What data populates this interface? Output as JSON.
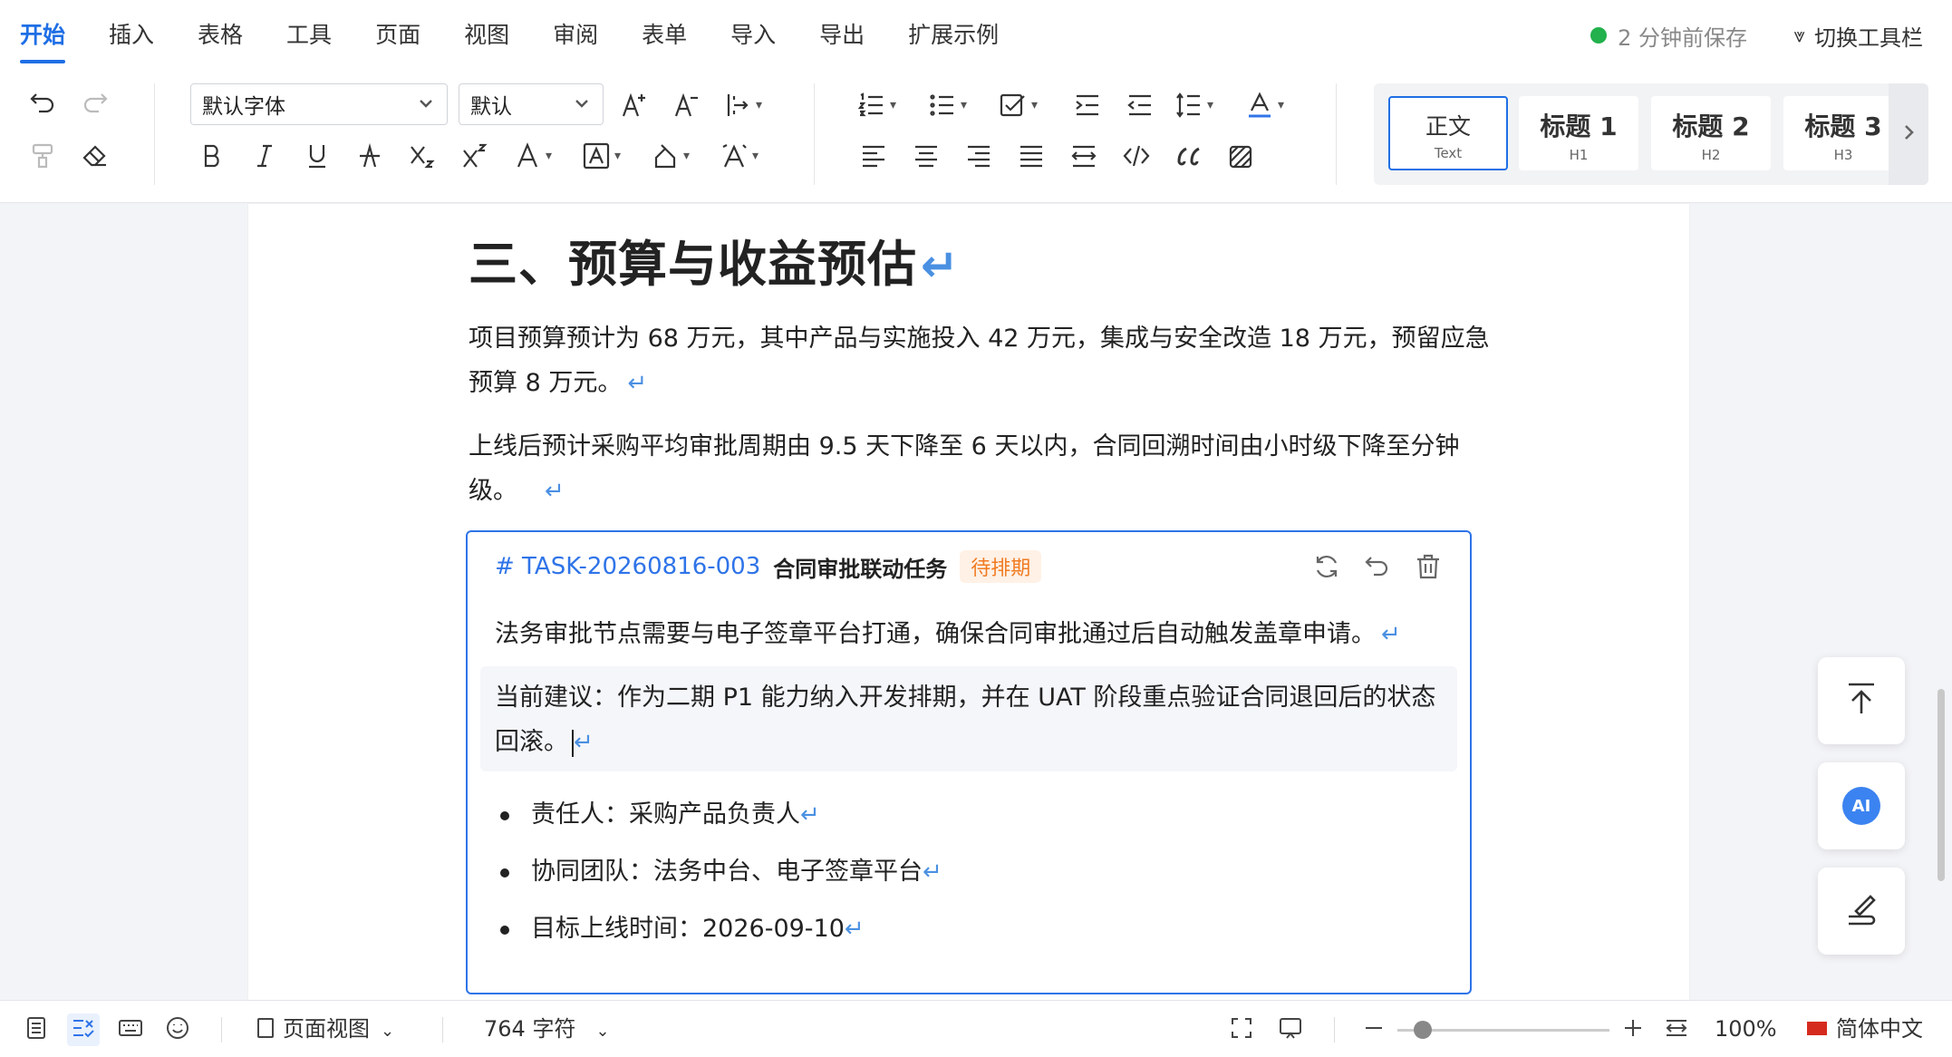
{
  "menu": {
    "tabs": [
      "开始",
      "插入",
      "表格",
      "工具",
      "页面",
      "视图",
      "审阅",
      "表单",
      "导入",
      "导出",
      "扩展示例"
    ],
    "active_index": 0,
    "save_status": "2 分钟前保存",
    "switch_toolbar": "切换工具栏"
  },
  "toolbar": {
    "font_family": "默认字体",
    "font_size": "默认",
    "styles": [
      {
        "title": "正文",
        "sub": "Text"
      },
      {
        "title": "标题 1",
        "sub": "H1"
      },
      {
        "title": "标题 2",
        "sub": "H2"
      },
      {
        "title": "标题 3",
        "sub": "H3"
      }
    ]
  },
  "document": {
    "heading": "三、预算与收益预估",
    "para1": "项目预算预计为 68 万元，其中产品与实施投入 42 万元，集成与安全改造 18 万元，预留应急预算 8 万元。",
    "para2": "上线后预计采购平均审批周期由 9.5 天下降至 6 天以内，合同回溯时间由小时级下降至分钟级。",
    "task": {
      "id": "# TASK-20260816-003",
      "name": "合同审批联动任务",
      "status": "待排期",
      "description": "法务审批节点需要与电子签章平台打通，确保合同审批通过后自动触发盖章申请。",
      "suggestion": "当前建议：作为二期 P1 能力纳入开发排期，并在 UAT 阶段重点验证合同退回后的状态回滚。",
      "bullets": [
        "责任人：采购产品负责人",
        "协同团队：法务中台、电子签章平台",
        "目标上线时间：2026-09-10"
      ]
    }
  },
  "floating": {
    "ai_label": "AI"
  },
  "statusbar": {
    "view_mode": "页面视图",
    "char_count": "764 字符",
    "zoom_level": "100%",
    "zoom_fraction": 0.12,
    "language": "简体中文"
  },
  "colors": {
    "accent": "#1f6fe5",
    "saved": "#22b14c",
    "badge": "#f07b21"
  }
}
